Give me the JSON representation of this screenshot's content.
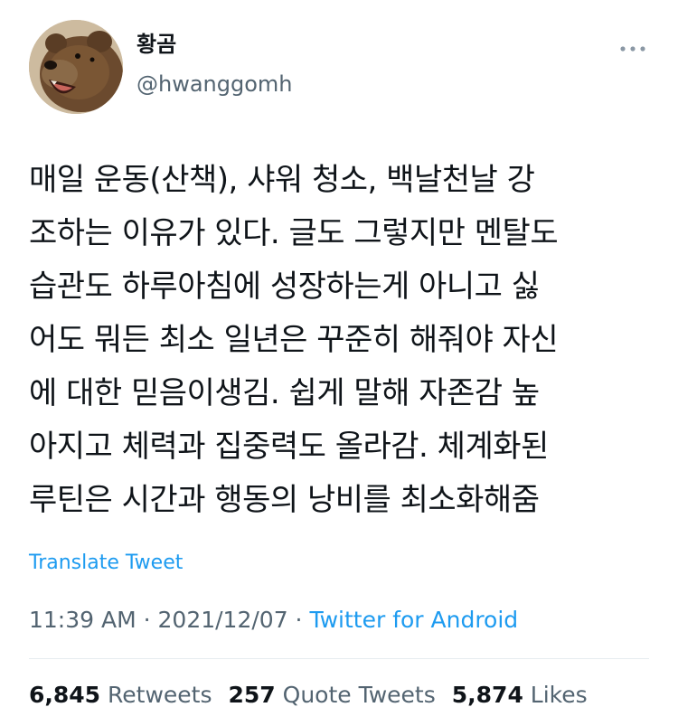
{
  "author": {
    "name": "황곰",
    "handle": "@hwanggomh",
    "avatar_icon": "brown-bear-avatar"
  },
  "more_icon": "more-horizontal-icon",
  "tweet": {
    "text": "매일 운동(산책), 샤워 청소, 백날천날 강\n조하는 이유가 있다. 글도 그렇지만 멘탈도\n습관도 하루아침에 성장하는게 아니고 싫\n어도 뭐든 최소 일년은 꾸준히 해줘야 자신\n에 대한 믿음이생김. 쉽게 말해 자존감 높\n아지고 체력과 집중력도 올라감. 체계화된\n루틴은 시간과 행동의 낭비를 최소화해줌",
    "translate_label": "Translate Tweet",
    "time": "11:39 AM",
    "separator1": " · ",
    "date": "2021/12/07",
    "separator2": " · ",
    "source": "Twitter for Android"
  },
  "stats": {
    "retweets_count": "6,845",
    "retweets_label": "Retweets",
    "quotes_count": "257",
    "quotes_label": "Quote Tweets",
    "likes_count": "5,874",
    "likes_label": "Likes"
  },
  "colors": {
    "accent": "#1d9bf0",
    "secondary_text": "#536471",
    "primary_text": "#0f1419"
  }
}
